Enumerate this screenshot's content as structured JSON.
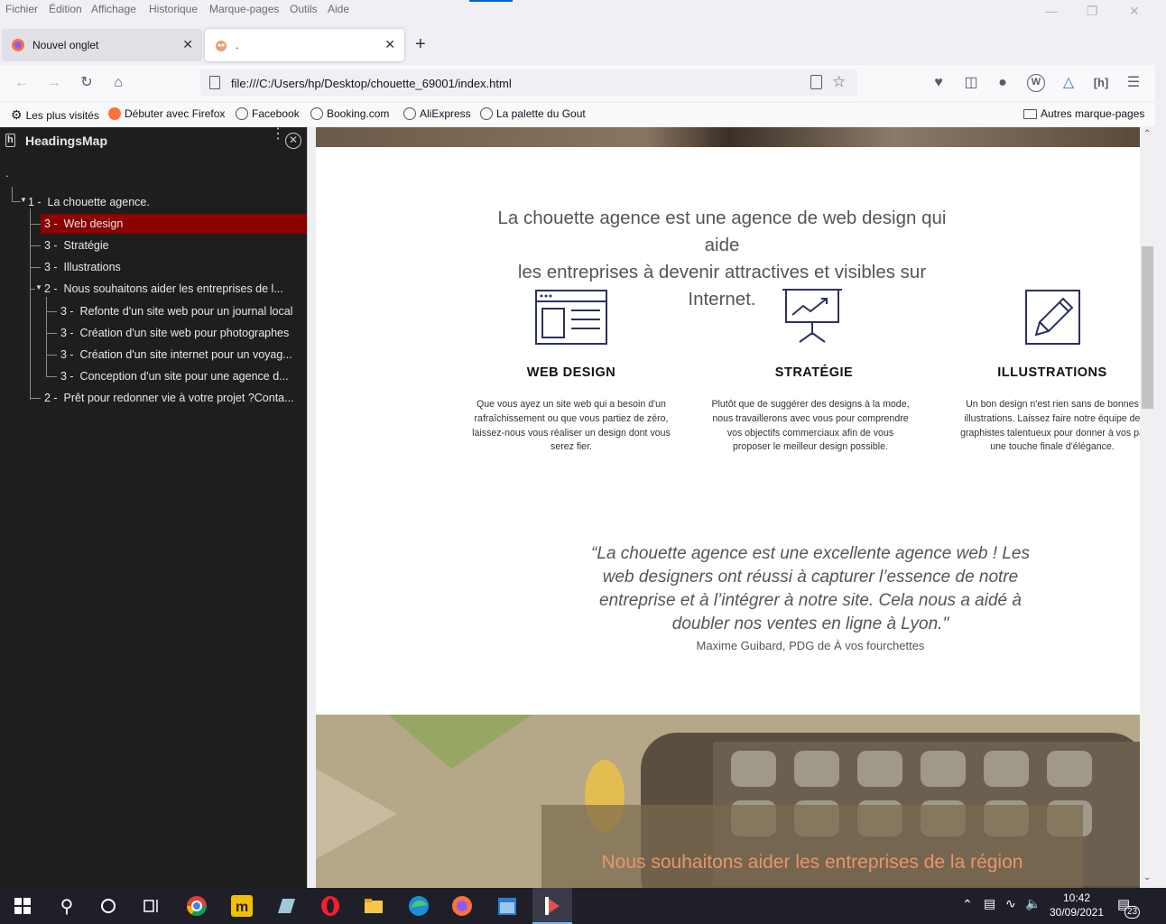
{
  "menubar": {
    "items": [
      "Fichier",
      "Édition",
      "Affichage",
      "Historique",
      "Marque-pages",
      "Outils",
      "Aide"
    ]
  },
  "tabs": [
    {
      "label": "Nouvel onglet",
      "active": false
    },
    {
      "label": ".",
      "active": true
    }
  ],
  "navbar": {
    "url": "file:///C:/Users/hp/Desktop/chouette_69001/index.html"
  },
  "bookmarks": {
    "items": [
      "Les plus visités",
      "Débuter avec Firefox",
      "Facebook",
      "Booking.com",
      "AliExpress",
      "La palette du Gout"
    ],
    "other": "Autres marque-pages"
  },
  "sidebar": {
    "title": "HeadingsMap",
    "root": ".",
    "items": [
      {
        "level": "1 -",
        "text": "La chouette agence."
      },
      {
        "level": "3 -",
        "text": "Web design",
        "selected": true
      },
      {
        "level": "3 -",
        "text": "Stratégie"
      },
      {
        "level": "3 -",
        "text": "Illustrations"
      },
      {
        "level": "2 -",
        "text": "Nous souhaitons aider les entreprises de l..."
      },
      {
        "level": "3 -",
        "text": "Refonte d'un site web pour un journal local"
      },
      {
        "level": "3 -",
        "text": "Création d'un site web pour photographes"
      },
      {
        "level": "3 -",
        "text": "Création d'un site internet pour un voyag..."
      },
      {
        "level": "3 -",
        "text": "Conception d'un site pour une agence d..."
      },
      {
        "level": "2 -",
        "text": "Prêt pour redonner vie à votre projet ?Conta..."
      }
    ]
  },
  "page": {
    "intro_line1": "La chouette agence est une agence de web design qui aide",
    "intro_line2": "les entreprises à devenir attractives et visibles sur Internet.",
    "services": [
      {
        "icon": "web-design-icon",
        "title": "WEB DESIGN",
        "lines": [
          "Que vous ayez un site web qui a besoin d'un",
          "rafraîchissement ou que vous partiez de zéro,",
          "laissez-nous vous réaliser un design dont vous",
          "serez fier."
        ]
      },
      {
        "icon": "strategy-icon",
        "title": "STRATÉGIE",
        "lines": [
          "Plutôt que de suggérer des designs à la mode,",
          "nous travaillerons avec vous pour comprendre",
          "vos objectifs commerciaux afin de vous",
          "proposer le meilleur design possible."
        ]
      },
      {
        "icon": "illustrations-icon",
        "title": "ILLUSTRATIONS",
        "lines": [
          "Un bon design n'est rien sans de bonnes",
          "illustrations. Laissez faire notre équipe de",
          "graphistes talentueux pour donner à vos pa",
          "une touche finale d'élégance."
        ]
      }
    ],
    "quote_lines": [
      "“La chouette agence est une excellente agence web ! Les",
      "web designers ont réussi à capturer l’essence de notre",
      "entreprise et à l’intégrer à notre site. Cela nous a aidé à",
      "doubler nos ventes en ligne à Lyon.\""
    ],
    "quote_author": "Maxime Guibard, PDG de À vos fourchettes",
    "banner_text": "Nous souhaitons aider les entreprises de la région"
  },
  "taskbar": {
    "time": "10:42",
    "date": "30/09/2021",
    "notifications": "23"
  },
  "colors": {
    "selected": "#8b0000",
    "icon_navy": "#2d3060",
    "banner_text": "#e8956a"
  }
}
